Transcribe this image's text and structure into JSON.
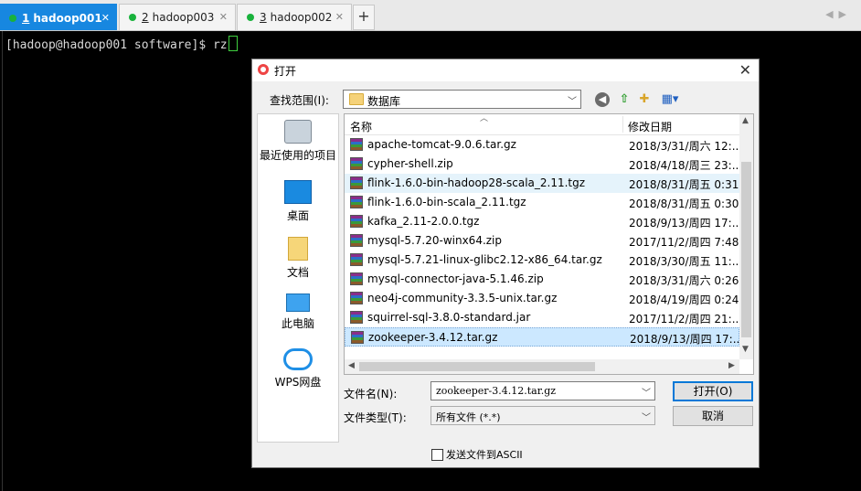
{
  "tabs": [
    {
      "num": "1",
      "label": "hadoop001",
      "close": "✕"
    },
    {
      "num": "2",
      "label": "hadoop003",
      "close": "✕"
    },
    {
      "num": "3",
      "label": "hadoop002",
      "close": "✕"
    }
  ],
  "tab_add": "+",
  "tab_nav": "◀▶",
  "terminal": {
    "prompt": "[hadoop@hadoop001 software]$ rz"
  },
  "dialog": {
    "title": "打开",
    "close": "✕",
    "lookin_label": "查找范围(I):",
    "lookin_value": "数据库",
    "places": [
      "最近使用的项目",
      "桌面",
      "文档",
      "此电脑",
      "WPS网盘"
    ],
    "columns": {
      "name": "名称",
      "date": "修改日期"
    },
    "files": [
      {
        "name": "apache-tomcat-9.0.6.tar.gz",
        "date": "2018/3/31/周六 12:.."
      },
      {
        "name": "cypher-shell.zip",
        "date": "2018/4/18/周三 23:.."
      },
      {
        "name": "flink-1.6.0-bin-hadoop28-scala_2.11.tgz",
        "date": "2018/8/31/周五 0:31"
      },
      {
        "name": "flink-1.6.0-bin-scala_2.11.tgz",
        "date": "2018/8/31/周五 0:30"
      },
      {
        "name": "kafka_2.11-2.0.0.tgz",
        "date": "2018/9/13/周四 17:.."
      },
      {
        "name": "mysql-5.7.20-winx64.zip",
        "date": "2017/11/2/周四 7:48"
      },
      {
        "name": "mysql-5.7.21-linux-glibc2.12-x86_64.tar.gz",
        "date": "2018/3/30/周五 11:.."
      },
      {
        "name": "mysql-connector-java-5.1.46.zip",
        "date": "2018/3/31/周六 0:26"
      },
      {
        "name": "neo4j-community-3.3.5-unix.tar.gz",
        "date": "2018/4/19/周四 0:24"
      },
      {
        "name": "squirrel-sql-3.8.0-standard.jar",
        "date": "2017/11/2/周四 21:.."
      },
      {
        "name": "zookeeper-3.4.12.tar.gz",
        "date": "2018/9/13/周四 17:.."
      }
    ],
    "filename_label": "文件名(N):",
    "filename_value": "zookeeper-3.4.12.tar.gz",
    "filetype_label": "文件类型(T):",
    "filetype_value": "所有文件 (*.*)",
    "open_button": "打开(O)",
    "cancel_button": "取消",
    "ascii_checkbox": "发送文件到ASCII"
  }
}
